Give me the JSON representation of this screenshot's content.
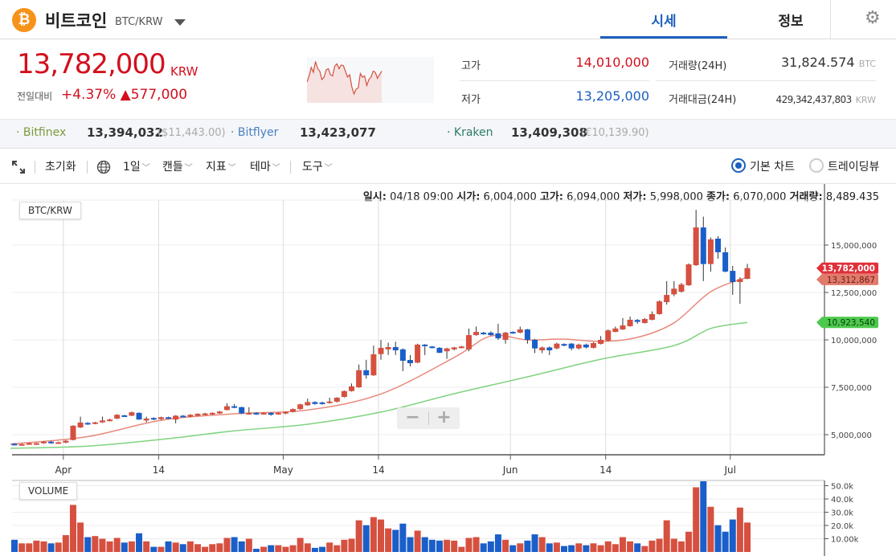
{
  "header": {
    "coin_name": "비트코인",
    "pair": "BTC/KRW",
    "logo_symbol": "₿",
    "tabs": [
      {
        "label": "시세",
        "active": true
      },
      {
        "label": "정보",
        "active": false
      }
    ],
    "settings_icon": "gear-icon"
  },
  "price": {
    "current": "13,782,000",
    "unit": "KRW",
    "change_label": "전일대비",
    "change_pct": "+4.37%",
    "change_abs": "▲577,000"
  },
  "sparkline": [
    70,
    95,
    130,
    110,
    155,
    125,
    115,
    80,
    90,
    120,
    125,
    100,
    95,
    135,
    145,
    125,
    140,
    138,
    115,
    90,
    100,
    50,
    20,
    40,
    45,
    105,
    90,
    95,
    55,
    80,
    90,
    115,
    110,
    85,
    100,
    115
  ],
  "stats": {
    "high_label": "고가",
    "high": "14,010,000",
    "low_label": "저가",
    "low": "13,205,000",
    "volume_label": "거래량(24H)",
    "volume": "31,824.574",
    "volume_unit": "BTC",
    "amount_label": "거래대금(24H)",
    "amount": "429,342,437,803",
    "amount_unit": "KRW"
  },
  "exchanges": [
    {
      "name": "· Bitfinex",
      "price": "13,394,032",
      "sub": "($11,443.00)",
      "color": "#7c9a3c"
    },
    {
      "name": "· Bitflyer",
      "price": "13,423,077",
      "sub": "",
      "color": "#4a7fc1"
    },
    {
      "name": "· Kraken",
      "price": "13,409,308",
      "sub": "(€10,139.90)",
      "color": "#2f7a6a"
    }
  ],
  "toolbar": {
    "reset": "초기화",
    "period": "1일",
    "candle": "캔들",
    "indicator": "지표",
    "theme": "테마",
    "tools": "도구",
    "basic_chart": "기본 차트",
    "tradingview": "트레이딩뷰",
    "selected": "basic_chart"
  },
  "info_line": {
    "date_label": "일시:",
    "date": "04/18 09:00",
    "open_label": "시가:",
    "open": "6,004,000",
    "high_label": "고가:",
    "high": "6,094,000",
    "low_label": "저가:",
    "low": "5,998,000",
    "close_label": "종가:",
    "close": "6,070,000",
    "vol_label": "거래량:",
    "vol": "8,489.435"
  },
  "colors": {
    "up": "#d6503f",
    "down": "#1a5fc9",
    "ma_fast": "#e8897c",
    "ma_slow": "#7fd37f",
    "price_red": "#d20f1d",
    "accent": "#1d5fbf"
  },
  "chart_data": {
    "type": "candlestick",
    "title": "BTC/KRW",
    "volume_title": "VOLUME",
    "ylim": [
      4200000,
      16900000
    ],
    "y_ticks": [
      {
        "v": 5000000,
        "label": "5,000,000"
      },
      {
        "v": 7500000,
        "label": "7,500,000"
      },
      {
        "v": 10000000,
        "label": "10,000,000"
      },
      {
        "v": 12500000,
        "label": "12,500,000"
      },
      {
        "v": 15000000,
        "label": "15,000,000"
      }
    ],
    "x_ticks": [
      {
        "date": "04/01",
        "label": "Apr"
      },
      {
        "date": "04/14",
        "label": "14"
      },
      {
        "date": "05/01",
        "label": "May"
      },
      {
        "date": "05/14",
        "label": "14"
      },
      {
        "date": "06/01",
        "label": "Jun"
      },
      {
        "date": "06/14",
        "label": "14"
      },
      {
        "date": "07/01",
        "label": "Jul"
      }
    ],
    "vol_ticks": [
      {
        "v": 50000,
        "label": "50.0k"
      },
      {
        "v": 40000,
        "label": "40.0k"
      },
      {
        "v": 30000,
        "label": "30.0k"
      },
      {
        "v": 20000,
        "label": "20.0k"
      },
      {
        "v": 10000,
        "label": "10.00k"
      }
    ],
    "grid": true,
    "price_tags": [
      {
        "label": "13,782,000",
        "value": 13782000,
        "color": "#e0303a",
        "text": "#ffffff"
      },
      {
        "label": "13,312,867",
        "value": 13312867,
        "color": "#e27a6c",
        "text": "#6a1f18"
      },
      {
        "label": "10,923,540",
        "value": 10923540,
        "color": "#4cc94c",
        "text": "#0b3d0b"
      }
    ],
    "dates": [
      "03/25",
      "03/26",
      "03/27",
      "03/28",
      "03/29",
      "03/30",
      "03/31",
      "04/01",
      "04/02",
      "04/03",
      "04/04",
      "04/05",
      "04/06",
      "04/07",
      "04/08",
      "04/09",
      "04/10",
      "04/11",
      "04/12",
      "04/13",
      "04/14",
      "04/15",
      "04/16",
      "04/17",
      "04/18",
      "04/19",
      "04/20",
      "04/21",
      "04/22",
      "04/23",
      "04/24",
      "04/25",
      "04/26",
      "04/27",
      "04/28",
      "04/29",
      "04/30",
      "05/01",
      "05/02",
      "05/03",
      "05/04",
      "05/05",
      "05/06",
      "05/07",
      "05/08",
      "05/09",
      "05/10",
      "05/11",
      "05/12",
      "05/13",
      "05/14",
      "05/15",
      "05/16",
      "05/17",
      "05/18",
      "05/19",
      "05/20",
      "05/21",
      "05/22",
      "05/23",
      "05/24",
      "05/25",
      "05/26",
      "05/27",
      "05/28",
      "05/29",
      "05/30",
      "05/31",
      "06/01",
      "06/02",
      "06/03",
      "06/04",
      "06/05",
      "06/06",
      "06/07",
      "06/08",
      "06/09",
      "06/10",
      "06/11",
      "06/12",
      "06/13",
      "06/14",
      "06/15",
      "06/16",
      "06/17",
      "06/18",
      "06/19",
      "06/20",
      "06/21",
      "06/22",
      "06/23",
      "06/24",
      "06/25",
      "06/26",
      "06/27",
      "06/28",
      "06/29",
      "06/30",
      "07/01",
      "07/02",
      "07/03"
    ],
    "ohlc": [
      [
        4520000,
        4560000,
        4450000,
        4480000
      ],
      [
        4470000,
        4530000,
        4440000,
        4500000
      ],
      [
        4500000,
        4580000,
        4470000,
        4550000
      ],
      [
        4500000,
        4580000,
        4470000,
        4550000
      ],
      [
        4550000,
        4660000,
        4520000,
        4630000
      ],
      [
        4630000,
        4670000,
        4520000,
        4550000
      ],
      [
        4550000,
        4630000,
        4520000,
        4600000
      ],
      [
        4580000,
        4720000,
        4550000,
        4680000
      ],
      [
        4720000,
        5500000,
        4700000,
        5470000
      ],
      [
        5380000,
        5950000,
        5350000,
        5640000
      ],
      [
        5620000,
        5660000,
        5520000,
        5550000
      ],
      [
        5580000,
        5680000,
        5550000,
        5650000
      ],
      [
        5650000,
        5950000,
        5620000,
        5750000
      ],
      [
        5720000,
        5840000,
        5700000,
        5800000
      ],
      [
        5850000,
        6080000,
        5820000,
        6050000
      ],
      [
        6020000,
        6050000,
        5950000,
        5980000
      ],
      [
        6000000,
        6220000,
        5980000,
        6180000
      ],
      [
        6150000,
        6180000,
        5780000,
        5800000
      ],
      [
        5750000,
        5950000,
        5650000,
        5850000
      ],
      [
        5880000,
        5920000,
        5760000,
        5800000
      ],
      [
        5820000,
        5950000,
        5780000,
        5920000
      ],
      [
        5920000,
        5950000,
        5820000,
        5860000
      ],
      [
        5800000,
        6030000,
        5600000,
        6000000
      ],
      [
        6000000,
        6040000,
        5920000,
        5950000
      ],
      [
        5950000,
        6080000,
        5920000,
        6050000
      ],
      [
        6000000,
        6130000,
        5970000,
        6100000
      ],
      [
        6050000,
        6150000,
        6020000,
        6120000
      ],
      [
        6080000,
        6180000,
        6050000,
        6150000
      ],
      [
        6120000,
        6250000,
        6100000,
        6220000
      ],
      [
        6300000,
        6650000,
        6280000,
        6500000
      ],
      [
        6500000,
        6620000,
        6400000,
        6420000
      ],
      [
        6450000,
        6480000,
        6080000,
        6120000
      ],
      [
        6100000,
        6450000,
        6050000,
        6150000
      ],
      [
        6150000,
        6180000,
        6040000,
        6080000
      ],
      [
        6100000,
        6180000,
        6060000,
        6150000
      ],
      [
        6150000,
        6180000,
        6000000,
        6050000
      ],
      [
        6100000,
        6180000,
        6060000,
        6150000
      ],
      [
        6120000,
        6230000,
        6080000,
        6200000
      ],
      [
        6200000,
        6380000,
        6170000,
        6350000
      ],
      [
        6350000,
        6630000,
        6320000,
        6600000
      ],
      [
        6550000,
        6900000,
        6520000,
        6720000
      ],
      [
        6720000,
        6760000,
        6580000,
        6620000
      ],
      [
        6700000,
        6740000,
        6580000,
        6620000
      ],
      [
        6680000,
        6950000,
        6640000,
        6750000
      ],
      [
        6740000,
        6980000,
        6700000,
        6950000
      ],
      [
        6990000,
        7330000,
        6960000,
        7300000
      ],
      [
        7300000,
        7700000,
        7270000,
        7550000
      ],
      [
        7500000,
        8700000,
        7470000,
        8400000
      ],
      [
        8400000,
        8950000,
        7950000,
        8130000
      ],
      [
        8130000,
        9700000,
        8100000,
        9240000
      ],
      [
        9250000,
        10000000,
        8950000,
        9580000
      ],
      [
        9500000,
        9850000,
        9200000,
        9620000
      ],
      [
        9620000,
        9900000,
        9200000,
        9450000
      ],
      [
        9500000,
        9550000,
        8350000,
        8900000
      ],
      [
        8940000,
        9200000,
        8600000,
        8770000
      ],
      [
        8800000,
        9800000,
        8770000,
        9750000
      ],
      [
        9750000,
        9780000,
        9200000,
        9700000
      ],
      [
        9650000,
        9680000,
        9550000,
        9600000
      ],
      [
        9580000,
        9620000,
        9300000,
        9320000
      ],
      [
        9400000,
        9580000,
        9000000,
        9550000
      ],
      [
        9500000,
        9630000,
        9450000,
        9600000
      ],
      [
        9580000,
        9680000,
        9550000,
        9650000
      ],
      [
        9500000,
        10600000,
        9400000,
        10250000
      ],
      [
        10250000,
        10700000,
        10220000,
        10420000
      ],
      [
        10380000,
        10420000,
        10270000,
        10300000
      ],
      [
        10380000,
        10450000,
        10220000,
        10250000
      ],
      [
        10340000,
        10850000,
        10000000,
        10080000
      ],
      [
        10000000,
        10420000,
        9800000,
        10380000
      ],
      [
        10420000,
        10450000,
        10320000,
        10350000
      ],
      [
        10380000,
        10700000,
        10350000,
        10550000
      ],
      [
        10550000,
        10580000,
        9800000,
        10000000
      ],
      [
        10000000,
        10050000,
        9300000,
        9550000
      ],
      [
        9450000,
        9650000,
        9300000,
        9600000
      ],
      [
        9600000,
        9650000,
        9200000,
        9450000
      ],
      [
        9550000,
        9850000,
        9500000,
        9800000
      ],
      [
        9780000,
        9820000,
        9660000,
        9700000
      ],
      [
        9800000,
        9840000,
        9450000,
        9550000
      ],
      [
        9550000,
        9800000,
        9500000,
        9750000
      ],
      [
        9750000,
        9800000,
        9550000,
        9600000
      ],
      [
        9580000,
        9880000,
        9550000,
        9830000
      ],
      [
        9790000,
        10200000,
        9760000,
        10000000
      ],
      [
        9960000,
        10550000,
        9930000,
        10500000
      ],
      [
        10420000,
        10700000,
        10400000,
        10600000
      ],
      [
        10550000,
        11150000,
        10520000,
        10760000
      ],
      [
        10720000,
        11230000,
        10700000,
        11060000
      ],
      [
        11050000,
        11100000,
        10850000,
        10950000
      ],
      [
        10890000,
        11150000,
        10860000,
        11100000
      ],
      [
        11060000,
        11500000,
        11030000,
        11360000
      ],
      [
        11360000,
        12080000,
        11330000,
        12030000
      ],
      [
        11990000,
        13100000,
        11860000,
        12370000
      ],
      [
        12400000,
        13100000,
        12300000,
        12700000
      ],
      [
        12540000,
        13000000,
        12500000,
        12920000
      ],
      [
        12880000,
        14030000,
        12850000,
        13980000
      ],
      [
        13940000,
        16860000,
        13900000,
        15930000
      ],
      [
        15930000,
        16500000,
        13100000,
        14000000
      ],
      [
        14000000,
        15400000,
        13600000,
        15300000
      ],
      [
        15340000,
        15470000,
        14280000,
        14620000
      ],
      [
        14620000,
        14870000,
        13560000,
        13600000
      ],
      [
        13640000,
        13900000,
        12370000,
        13050000
      ],
      [
        13050000,
        13300000,
        11900000,
        13200000
      ],
      [
        13220000,
        14010000,
        13200000,
        13782000
      ]
    ],
    "volume": [
      9200,
      6500,
      6500,
      8600,
      8000,
      6500,
      7100,
      12700,
      35500,
      22200,
      11200,
      12000,
      10000,
      8000,
      10600,
      7100,
      8000,
      14100,
      8000,
      3900,
      3900,
      8000,
      7100,
      5900,
      8000,
      5900,
      3900,
      5900,
      6500,
      10600,
      11200,
      8000,
      10000,
      2400,
      3900,
      5100,
      5100,
      3900,
      5100,
      10600,
      6500,
      3100,
      3900,
      7100,
      5100,
      9200,
      10000,
      23900,
      20200,
      26300,
      24500,
      17800,
      16700,
      21400,
      11200,
      16100,
      11200,
      9200,
      8600,
      9200,
      8600,
      3900,
      10600,
      11200,
      6500,
      8000,
      13300,
      9200,
      5100,
      6500,
      8600,
      13300,
      11200,
      6500,
      7100,
      4500,
      5100,
      6500,
      5100,
      6500,
      5100,
      8000,
      5900,
      11200,
      8000,
      6500,
      4500,
      8600,
      10000,
      23900,
      10000,
      8000,
      15300,
      48800,
      53500,
      34100,
      20200,
      15300,
      24500,
      33500,
      22200
    ],
    "ma_fast": [
      {
        "i": 0,
        "v": 4500000
      },
      {
        "i": 10,
        "v": 4900000
      },
      {
        "i": 20,
        "v": 5760000
      },
      {
        "i": 30,
        "v": 6100000
      },
      {
        "i": 40,
        "v": 6300000
      },
      {
        "i": 50,
        "v": 7150000
      },
      {
        "i": 60,
        "v": 9070000
      },
      {
        "i": 65,
        "v": 10200000
      },
      {
        "i": 70,
        "v": 10000000
      },
      {
        "i": 75,
        "v": 10040000
      },
      {
        "i": 80,
        "v": 9920000
      },
      {
        "i": 85,
        "v": 10130000
      },
      {
        "i": 90,
        "v": 10900000
      },
      {
        "i": 95,
        "v": 12540000
      },
      {
        "i": 100,
        "v": 13312867
      }
    ],
    "ma_slow": [
      {
        "i": 0,
        "v": 4280000
      },
      {
        "i": 10,
        "v": 4400000
      },
      {
        "i": 20,
        "v": 4750000
      },
      {
        "i": 30,
        "v": 5200000
      },
      {
        "i": 40,
        "v": 5550000
      },
      {
        "i": 50,
        "v": 6190000
      },
      {
        "i": 60,
        "v": 7160000
      },
      {
        "i": 70,
        "v": 8050000
      },
      {
        "i": 80,
        "v": 8980000
      },
      {
        "i": 90,
        "v": 9700000
      },
      {
        "i": 95,
        "v": 10600000
      },
      {
        "i": 100,
        "v": 10923540
      }
    ]
  }
}
